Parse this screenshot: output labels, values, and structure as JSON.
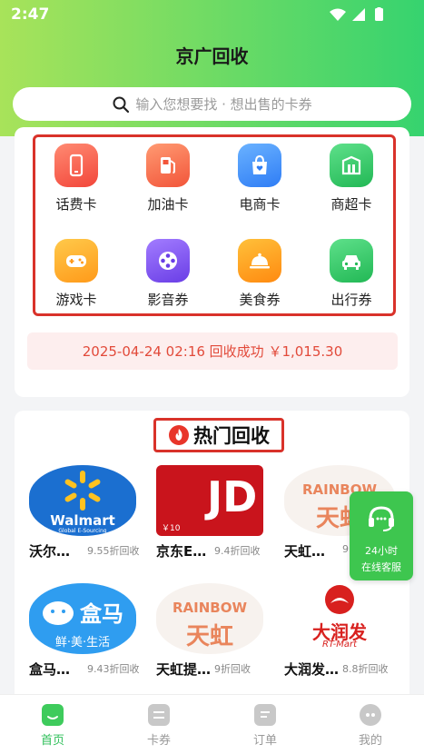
{
  "status_bar": {
    "time": "2:47"
  },
  "header": {
    "title": "京广回收",
    "search_placeholder": "输入您想要找 · 想出售的卡券"
  },
  "categories": [
    {
      "label": "话费卡",
      "icon": "phone-icon",
      "color": "#ff6a5a"
    },
    {
      "label": "加油卡",
      "icon": "fuel-pump-icon",
      "color": "#ff7a4a"
    },
    {
      "label": "电商卡",
      "icon": "shopping-bag-icon",
      "color": "#4a9bff"
    },
    {
      "label": "商超卡",
      "icon": "store-icon",
      "color": "#3dcc6a"
    },
    {
      "label": "游戏卡",
      "icon": "gamepad-icon",
      "color": "#ffb02a"
    },
    {
      "label": "影音券",
      "icon": "film-reel-icon",
      "color": "#8a5cf0"
    },
    {
      "label": "美食券",
      "icon": "food-cloche-icon",
      "color": "#ff9c1a"
    },
    {
      "label": "出行券",
      "icon": "car-icon",
      "color": "#3dcc6a"
    }
  ],
  "notice": "2025-04-24 02:16 回收成功 ￥1,015.30",
  "hot": {
    "title": "热门回收",
    "products": [
      {
        "name": "沃尔…",
        "rate": "9.55折回收",
        "logo": "walmart-logo",
        "logo_text": "Walmart",
        "logo_sub": "Global E-Sourcing"
      },
      {
        "name": "京东E…",
        "rate": "9.4折回收",
        "logo": "jd-ecard-logo",
        "logo_text": "JD",
        "logo_sub": "￥10"
      },
      {
        "name": "天虹…",
        "rate": "9",
        "logo": "rainbow-logo",
        "logo_text": "RAINBOW",
        "logo_sub": "天虹"
      },
      {
        "name": "盒马…",
        "rate": "9.43折回收",
        "logo": "hema-logo",
        "logo_text": "盒马",
        "logo_sub": "鲜·美·生活"
      },
      {
        "name": "天虹提…",
        "rate": "9折回收",
        "logo": "rainbow-logo",
        "logo_text": "RAINBOW",
        "logo_sub": "天虹"
      },
      {
        "name": "大润发…",
        "rate": "8.8折回收",
        "logo": "rt-mart-logo",
        "logo_text": "大润发",
        "logo_sub": "RT-Mart"
      }
    ]
  },
  "service": {
    "line1": "24小时",
    "line2": "在线客服"
  },
  "tabs": [
    {
      "label": "首页",
      "icon": "home-icon",
      "active": true
    },
    {
      "label": "卡券",
      "icon": "coupon-icon",
      "active": false
    },
    {
      "label": "订单",
      "icon": "order-icon",
      "active": false
    },
    {
      "label": "我的",
      "icon": "profile-icon",
      "active": false
    }
  ]
}
